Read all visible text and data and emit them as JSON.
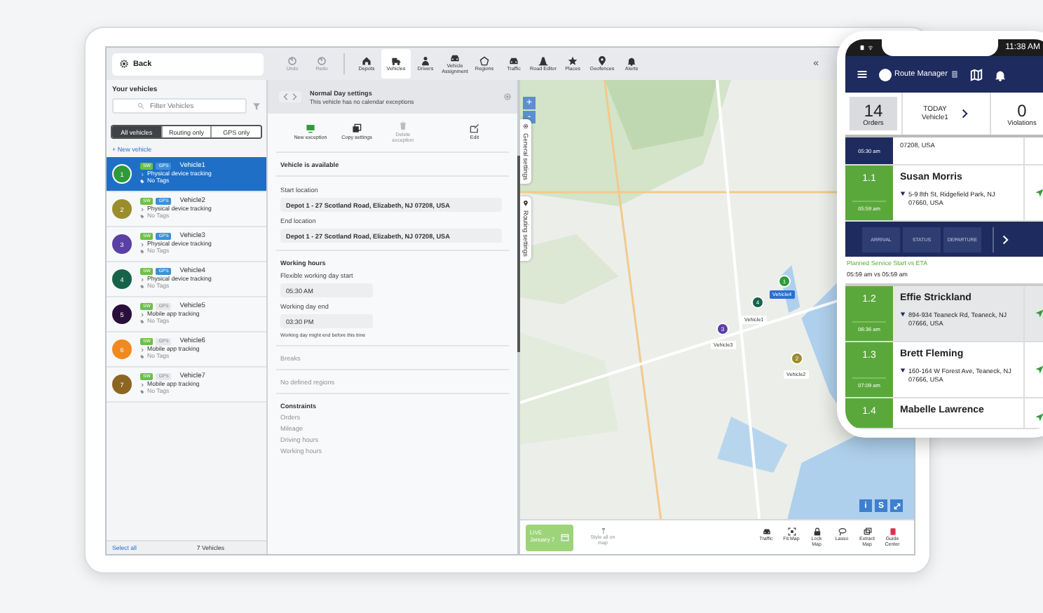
{
  "toolbar": {
    "back": "Back",
    "history": [
      {
        "label": "Undo",
        "disabled": true
      },
      {
        "label": "Redo",
        "disabled": true
      }
    ],
    "views": [
      {
        "label": "Depots",
        "selected": false
      },
      {
        "label": "Vehicles",
        "selected": true
      },
      {
        "label": "Drivers",
        "selected": false
      },
      {
        "label": "Vehicle Assignment",
        "selected": false
      },
      {
        "label": "Regions",
        "selected": false
      },
      {
        "label": "Traffic",
        "selected": false
      },
      {
        "label": "Road Editor",
        "selected": false
      },
      {
        "label": "Places",
        "selected": false
      },
      {
        "label": "Geofences",
        "selected": false
      },
      {
        "label": "Alerts",
        "selected": false
      }
    ],
    "collapse": "«"
  },
  "sidebar": {
    "title": "Your vehicles",
    "filter_placeholder": "Filter Vehicles",
    "segments": [
      {
        "label": "All vehicles",
        "selected": true
      },
      {
        "label": "Routing only",
        "selected": false
      },
      {
        "label": "GPS only",
        "selected": false
      }
    ],
    "new_vehicle": "+ New vehicle",
    "vehicles": [
      {
        "number": "1",
        "name": "Vehicle1",
        "color": "#2e9a3c",
        "selected": true,
        "badges": [
          {
            "label": "SW",
            "on": true
          },
          {
            "label": "GPS",
            "on": true
          }
        ],
        "tracking": "Physical device tracking",
        "tags": "No Tags"
      },
      {
        "number": "2",
        "name": "Vehicle2",
        "color": "#9a8e2c",
        "selected": false,
        "badges": [
          {
            "label": "SW",
            "on": true
          },
          {
            "label": "GPS",
            "on": true
          }
        ],
        "tracking": "Physical device tracking",
        "tags": "No Tags"
      },
      {
        "number": "3",
        "name": "Vehicle3",
        "color": "#5a3fa6",
        "selected": false,
        "badges": [
          {
            "label": "SW",
            "on": true
          },
          {
            "label": "GPS",
            "on": true
          }
        ],
        "tracking": "Physical device tracking",
        "tags": "No Tags"
      },
      {
        "number": "4",
        "name": "Vehicle4",
        "color": "#17634a",
        "selected": false,
        "badges": [
          {
            "label": "SW",
            "on": true
          },
          {
            "label": "GPS",
            "on": true
          }
        ],
        "tracking": "Physical device tracking",
        "tags": "No Tags"
      },
      {
        "number": "5",
        "name": "Vehicle5",
        "color": "#2b0f3b",
        "selected": false,
        "badges": [
          {
            "label": "SW",
            "on": true
          },
          {
            "label": "GPS",
            "on": false
          }
        ],
        "tracking": "Mobile app tracking",
        "tags": "No Tags"
      },
      {
        "number": "6",
        "name": "Vehicle6",
        "color": "#f08a1e",
        "selected": false,
        "badges": [
          {
            "label": "SW",
            "on": true
          },
          {
            "label": "GPS",
            "on": false
          }
        ],
        "tracking": "Mobile app tracking",
        "tags": "No Tags"
      },
      {
        "number": "7",
        "name": "Vehicle7",
        "color": "#8b6622",
        "selected": false,
        "badges": [
          {
            "label": "SW",
            "on": true
          },
          {
            "label": "GPS",
            "on": false
          }
        ],
        "tracking": "Mobile app tracking",
        "tags": "No Tags"
      }
    ],
    "select_all": "Select all",
    "count": "7 Vehicles"
  },
  "panel": {
    "title": "Normal Day settings",
    "subtitle": "This vehicle has no calendar exceptions",
    "actions": [
      {
        "label": "New exception",
        "disabled": false
      },
      {
        "label": "Copy settings",
        "disabled": false
      },
      {
        "label": "Delete exception",
        "disabled": true
      },
      {
        "label": "Edit",
        "disabled": false
      }
    ],
    "groups": [
      {
        "items": [
          {
            "kind": "heading",
            "text": "Vehicle is available"
          }
        ]
      },
      {
        "items": [
          {
            "kind": "label",
            "text": "Start location"
          },
          {
            "kind": "field",
            "text": "Depot 1 - 27 Scotland Road, Elizabeth, NJ 07208, USA"
          },
          {
            "kind": "label",
            "text": "End location"
          },
          {
            "kind": "field",
            "text": "Depot 1 - 27 Scotland Road, Elizabeth, NJ 07208, USA"
          }
        ]
      },
      {
        "items": [
          {
            "kind": "heading",
            "text": "Working hours"
          },
          {
            "kind": "label",
            "text": "Flexible working day start"
          },
          {
            "kind": "short_field",
            "text": "05:30 AM"
          },
          {
            "kind": "label",
            "text": "Working day end"
          },
          {
            "kind": "short_field",
            "text": "03:30 PM"
          },
          {
            "kind": "note",
            "text": "Working day might end before this time"
          }
        ]
      },
      {
        "items": [
          {
            "kind": "muted",
            "text": "Breaks"
          }
        ]
      },
      {
        "items": [
          {
            "kind": "muted",
            "text": "No defined regions"
          }
        ]
      },
      {
        "items": [
          {
            "kind": "heading",
            "text": "Constraints"
          },
          {
            "kind": "muted",
            "text": "Orders"
          },
          {
            "kind": "muted",
            "text": "Mileage"
          },
          {
            "kind": "muted",
            "text": "Driving hours"
          },
          {
            "kind": "muted",
            "text": "Working hours"
          }
        ]
      }
    ]
  },
  "map": {
    "zoom_in": "+",
    "zoom_out": "-",
    "tabs": [
      {
        "label": "General settings"
      },
      {
        "label": "Routing settings"
      }
    ],
    "markers": [
      {
        "number": "1",
        "color": "#2e9a3c"
      },
      {
        "number": "4",
        "color": "#17634a"
      },
      {
        "number": "3",
        "color": "#5a3fa6"
      },
      {
        "number": "2",
        "color": "#9a8e2c"
      }
    ],
    "labels": [
      {
        "text": "Vehicle4",
        "selected": true
      },
      {
        "text": "Vehicle1",
        "selected": false
      },
      {
        "text": "Vehicle3",
        "selected": false
      },
      {
        "text": "Vehicle2",
        "selected": false
      }
    ],
    "corner_buttons": [
      "i",
      "S"
    ],
    "live": {
      "label": "LIVE",
      "date": "January 7"
    },
    "style_all": {
      "label": "Style all on map",
      "disabled": true
    },
    "tools": [
      "Traffic",
      "Fit Map",
      "Lock Map",
      "Lasso",
      "Extract Map",
      "Guide Center"
    ]
  },
  "phone": {
    "time": "11:38 AM",
    "app_name": "Route Manager",
    "summary": {
      "orders": "14",
      "orders_label": "Orders",
      "day": "TODAY",
      "vehicle": "Vehicle1",
      "violations": "0",
      "violations_label": "Violations"
    },
    "actions": [
      "ARRIVAL",
      "STATUS",
      "DEPARTURE"
    ],
    "eta_title": "Planned Service Start vs ETA",
    "eta": "05:59 am vs 05:59 am",
    "stops": [
      {
        "kind": "partial",
        "time": "05:30 am",
        "address": "07208, USA"
      },
      {
        "kind": "stop",
        "seq": "1.1",
        "time": "05:59 am",
        "name": "Susan Morris",
        "address": "5-9 8th St, Ridgefield Park, NJ 07660, USA",
        "selected": false,
        "expanded": true
      },
      {
        "kind": "stop",
        "seq": "1.2",
        "time": "06:36 am",
        "name": "Effie Strickland",
        "address": "894-934 Teaneck Rd, Teaneck, NJ 07666, USA",
        "selected": true,
        "expanded": false
      },
      {
        "kind": "stop",
        "seq": "1.3",
        "time": "07:09 am",
        "name": "Brett Fleming",
        "address": "160-164 W Forest Ave, Teaneck, NJ 07666, USA",
        "selected": false,
        "expanded": false
      },
      {
        "kind": "cut",
        "seq": "1.4",
        "name": "Mabelle Lawrence"
      }
    ]
  }
}
